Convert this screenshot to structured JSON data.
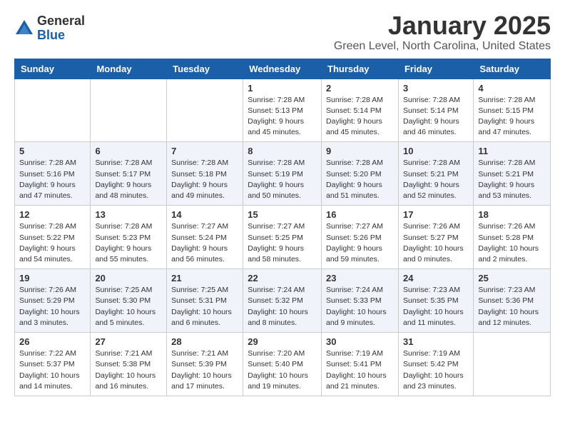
{
  "logo": {
    "general": "General",
    "blue": "Blue"
  },
  "title": "January 2025",
  "subtitle": "Green Level, North Carolina, United States",
  "weekdays": [
    "Sunday",
    "Monday",
    "Tuesday",
    "Wednesday",
    "Thursday",
    "Friday",
    "Saturday"
  ],
  "weeks": [
    [
      {
        "day": "",
        "info": ""
      },
      {
        "day": "",
        "info": ""
      },
      {
        "day": "",
        "info": ""
      },
      {
        "day": "1",
        "info": "Sunrise: 7:28 AM\nSunset: 5:13 PM\nDaylight: 9 hours and 45 minutes."
      },
      {
        "day": "2",
        "info": "Sunrise: 7:28 AM\nSunset: 5:14 PM\nDaylight: 9 hours and 45 minutes."
      },
      {
        "day": "3",
        "info": "Sunrise: 7:28 AM\nSunset: 5:14 PM\nDaylight: 9 hours and 46 minutes."
      },
      {
        "day": "4",
        "info": "Sunrise: 7:28 AM\nSunset: 5:15 PM\nDaylight: 9 hours and 47 minutes."
      }
    ],
    [
      {
        "day": "5",
        "info": "Sunrise: 7:28 AM\nSunset: 5:16 PM\nDaylight: 9 hours and 47 minutes."
      },
      {
        "day": "6",
        "info": "Sunrise: 7:28 AM\nSunset: 5:17 PM\nDaylight: 9 hours and 48 minutes."
      },
      {
        "day": "7",
        "info": "Sunrise: 7:28 AM\nSunset: 5:18 PM\nDaylight: 9 hours and 49 minutes."
      },
      {
        "day": "8",
        "info": "Sunrise: 7:28 AM\nSunset: 5:19 PM\nDaylight: 9 hours and 50 minutes."
      },
      {
        "day": "9",
        "info": "Sunrise: 7:28 AM\nSunset: 5:20 PM\nDaylight: 9 hours and 51 minutes."
      },
      {
        "day": "10",
        "info": "Sunrise: 7:28 AM\nSunset: 5:21 PM\nDaylight: 9 hours and 52 minutes."
      },
      {
        "day": "11",
        "info": "Sunrise: 7:28 AM\nSunset: 5:21 PM\nDaylight: 9 hours and 53 minutes."
      }
    ],
    [
      {
        "day": "12",
        "info": "Sunrise: 7:28 AM\nSunset: 5:22 PM\nDaylight: 9 hours and 54 minutes."
      },
      {
        "day": "13",
        "info": "Sunrise: 7:28 AM\nSunset: 5:23 PM\nDaylight: 9 hours and 55 minutes."
      },
      {
        "day": "14",
        "info": "Sunrise: 7:27 AM\nSunset: 5:24 PM\nDaylight: 9 hours and 56 minutes."
      },
      {
        "day": "15",
        "info": "Sunrise: 7:27 AM\nSunset: 5:25 PM\nDaylight: 9 hours and 58 minutes."
      },
      {
        "day": "16",
        "info": "Sunrise: 7:27 AM\nSunset: 5:26 PM\nDaylight: 9 hours and 59 minutes."
      },
      {
        "day": "17",
        "info": "Sunrise: 7:26 AM\nSunset: 5:27 PM\nDaylight: 10 hours and 0 minutes."
      },
      {
        "day": "18",
        "info": "Sunrise: 7:26 AM\nSunset: 5:28 PM\nDaylight: 10 hours and 2 minutes."
      }
    ],
    [
      {
        "day": "19",
        "info": "Sunrise: 7:26 AM\nSunset: 5:29 PM\nDaylight: 10 hours and 3 minutes."
      },
      {
        "day": "20",
        "info": "Sunrise: 7:25 AM\nSunset: 5:30 PM\nDaylight: 10 hours and 5 minutes."
      },
      {
        "day": "21",
        "info": "Sunrise: 7:25 AM\nSunset: 5:31 PM\nDaylight: 10 hours and 6 minutes."
      },
      {
        "day": "22",
        "info": "Sunrise: 7:24 AM\nSunset: 5:32 PM\nDaylight: 10 hours and 8 minutes."
      },
      {
        "day": "23",
        "info": "Sunrise: 7:24 AM\nSunset: 5:33 PM\nDaylight: 10 hours and 9 minutes."
      },
      {
        "day": "24",
        "info": "Sunrise: 7:23 AM\nSunset: 5:35 PM\nDaylight: 10 hours and 11 minutes."
      },
      {
        "day": "25",
        "info": "Sunrise: 7:23 AM\nSunset: 5:36 PM\nDaylight: 10 hours and 12 minutes."
      }
    ],
    [
      {
        "day": "26",
        "info": "Sunrise: 7:22 AM\nSunset: 5:37 PM\nDaylight: 10 hours and 14 minutes."
      },
      {
        "day": "27",
        "info": "Sunrise: 7:21 AM\nSunset: 5:38 PM\nDaylight: 10 hours and 16 minutes."
      },
      {
        "day": "28",
        "info": "Sunrise: 7:21 AM\nSunset: 5:39 PM\nDaylight: 10 hours and 17 minutes."
      },
      {
        "day": "29",
        "info": "Sunrise: 7:20 AM\nSunset: 5:40 PM\nDaylight: 10 hours and 19 minutes."
      },
      {
        "day": "30",
        "info": "Sunrise: 7:19 AM\nSunset: 5:41 PM\nDaylight: 10 hours and 21 minutes."
      },
      {
        "day": "31",
        "info": "Sunrise: 7:19 AM\nSunset: 5:42 PM\nDaylight: 10 hours and 23 minutes."
      },
      {
        "day": "",
        "info": ""
      }
    ]
  ]
}
